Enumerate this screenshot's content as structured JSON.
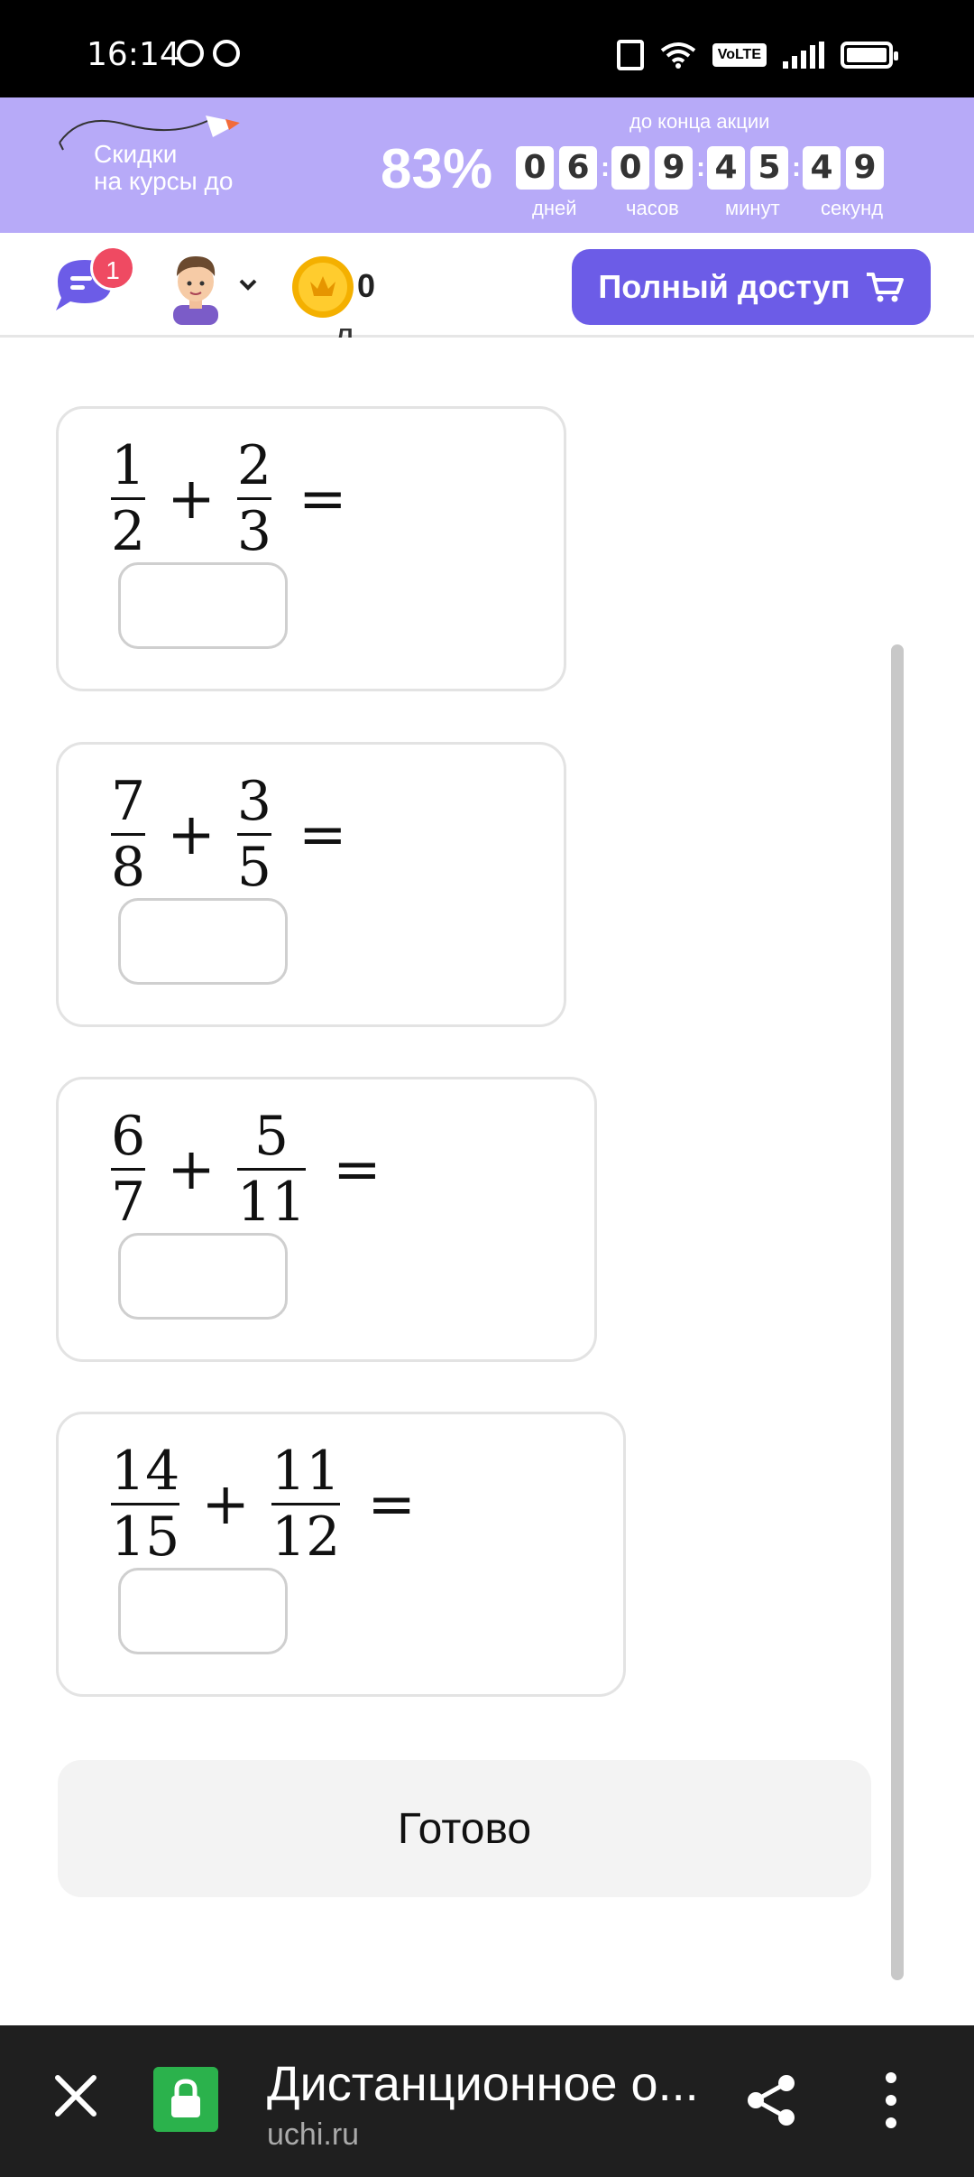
{
  "status_bar": {
    "time": "16:14",
    "volte": "VoLTE"
  },
  "promo": {
    "text_line1": "Скидки",
    "text_line2": "на курсы до",
    "percent": "83%",
    "caption": "до конца акции",
    "countdown": {
      "days": [
        "0",
        "6"
      ],
      "hours": [
        "0",
        "9"
      ],
      "minutes": [
        "4",
        "5"
      ],
      "seconds": [
        "4",
        "9"
      ]
    },
    "labels": {
      "days": "дней",
      "hours": "часов",
      "minutes": "минут",
      "seconds": "секунд"
    }
  },
  "header": {
    "chat_badge": "1",
    "coins": "0",
    "full_access_label": "Полный доступ"
  },
  "partial_text": "д , ",
  "tasks": [
    {
      "a": {
        "num": "1",
        "den": "2"
      },
      "op": "+",
      "b": {
        "num": "2",
        "den": "3"
      },
      "eq": "="
    },
    {
      "a": {
        "num": "7",
        "den": "8"
      },
      "op": "+",
      "b": {
        "num": "3",
        "den": "5"
      },
      "eq": "="
    },
    {
      "a": {
        "num": "6",
        "den": "7"
      },
      "op": "+",
      "b": {
        "num": "5",
        "den": "11"
      },
      "eq": "="
    },
    {
      "a": {
        "num": "14",
        "den": "15"
      },
      "op": "+",
      "b": {
        "num": "11",
        "den": "12"
      },
      "eq": "="
    }
  ],
  "done_label": "Готово",
  "browser": {
    "title": "Дистанционное о...",
    "domain": "uchi.ru"
  },
  "colors": {
    "promo_bg": "#b7aaf8",
    "accent": "#6c5ce7",
    "badge": "#ef4a62",
    "coin": "#f4b000",
    "lock": "#2bb24c"
  }
}
